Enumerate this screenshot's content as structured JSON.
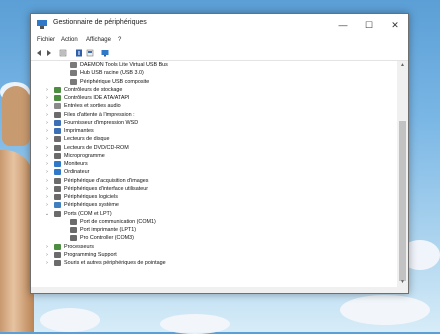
{
  "window": {
    "title": "Gestionnaire de périphériques",
    "minimize_glyph": "—",
    "maximize_glyph": "☐",
    "close_glyph": "✕"
  },
  "menu": [
    "Fichier",
    "Action",
    "Affichage",
    "?"
  ],
  "toolbar_icons": [
    "back-arrow-icon",
    "forward-arrow-icon",
    "properties-icon",
    "help-icon",
    "device-view-icon",
    "monitor-icon"
  ],
  "tree": [
    {
      "label": "DAEMON Tools Lite Virtual USB Bus",
      "level": 2,
      "expander": "",
      "icon": "usb-icon",
      "color": "#7a7a7a"
    },
    {
      "label": "Hub USB racine (USB 3.0)",
      "level": 2,
      "expander": "",
      "icon": "usb-icon",
      "color": "#7a7a7a"
    },
    {
      "label": "Périphérique USB composite",
      "level": 2,
      "expander": "",
      "icon": "usb-icon",
      "color": "#7a7a7a"
    },
    {
      "label": "Contrôleurs de stockage",
      "level": 1,
      "expander": "›",
      "icon": "storage-controller-icon",
      "color": "#4c8d3f"
    },
    {
      "label": "Contrôleurs IDE ATA/ATAPI",
      "level": 1,
      "expander": "›",
      "icon": "ide-controller-icon",
      "color": "#4c8d3f"
    },
    {
      "label": "Entrées et sorties audio",
      "level": 1,
      "expander": "›",
      "icon": "audio-icon",
      "color": "#8a8a8a"
    },
    {
      "label": "Files d'attente à l'impression :",
      "level": 1,
      "expander": "›",
      "icon": "print-queue-icon",
      "color": "#6b6b6b"
    },
    {
      "label": "Fournisseur d'impression WSD",
      "level": 1,
      "expander": "›",
      "icon": "wsd-printer-icon",
      "color": "#3b6fb6"
    },
    {
      "label": "Imprimantes",
      "level": 1,
      "expander": "›",
      "icon": "printer-icon",
      "color": "#3b6fb6"
    },
    {
      "label": "Lecteurs de disque",
      "level": 1,
      "expander": "›",
      "icon": "disk-drive-icon",
      "color": "#6b6b6b"
    },
    {
      "label": "Lecteurs de DVD/CD-ROM",
      "level": 1,
      "expander": "›",
      "icon": "dvd-icon",
      "color": "#6b6b6b"
    },
    {
      "label": "Microprogramme",
      "level": 1,
      "expander": "›",
      "icon": "firmware-icon",
      "color": "#6b6b6b"
    },
    {
      "label": "Moniteurs",
      "level": 1,
      "expander": "›",
      "icon": "monitor-icon",
      "color": "#2f79c8"
    },
    {
      "label": "Ordinateur",
      "level": 1,
      "expander": "›",
      "icon": "computer-icon",
      "color": "#2f79c8"
    },
    {
      "label": "Périphérique d'acquisition d'images",
      "level": 1,
      "expander": "›",
      "icon": "camera-icon",
      "color": "#6b6b6b"
    },
    {
      "label": "Périphériques d'interface utilisateur",
      "level": 1,
      "expander": "›",
      "icon": "hid-icon",
      "color": "#6b6b6b"
    },
    {
      "label": "Périphériques logiciels",
      "level": 1,
      "expander": "›",
      "icon": "software-device-icon",
      "color": "#6b6b6b"
    },
    {
      "label": "Périphériques système",
      "level": 1,
      "expander": "›",
      "icon": "system-device-icon",
      "color": "#3f7fc0"
    },
    {
      "label": "Ports (COM et LPT)",
      "level": 1,
      "expander": "⌄",
      "icon": "port-icon",
      "color": "#6b6b6b"
    },
    {
      "label": "Port de communication (COM1)",
      "level": 2,
      "expander": "",
      "icon": "port-icon",
      "color": "#6b6b6b"
    },
    {
      "label": "Port imprimante (LPT1)",
      "level": 2,
      "expander": "",
      "icon": "port-icon",
      "color": "#6b6b6b"
    },
    {
      "label": "Pro Controller (COM3)",
      "level": 2,
      "expander": "",
      "icon": "port-icon",
      "color": "#6b6b6b"
    },
    {
      "label": "Processeurs",
      "level": 1,
      "expander": "›",
      "icon": "processor-icon",
      "color": "#4c8d3f"
    },
    {
      "label": "Programming Support",
      "level": 1,
      "expander": "›",
      "icon": "programming-support-icon",
      "color": "#6b6b6b"
    },
    {
      "label": "Souris et autres périphériques de pointage",
      "level": 1,
      "expander": "›",
      "icon": "mouse-icon",
      "color": "#6b6b6b"
    }
  ],
  "scroll": {
    "up_glyph": "▲",
    "down_glyph": "▼",
    "position": 0.45
  }
}
